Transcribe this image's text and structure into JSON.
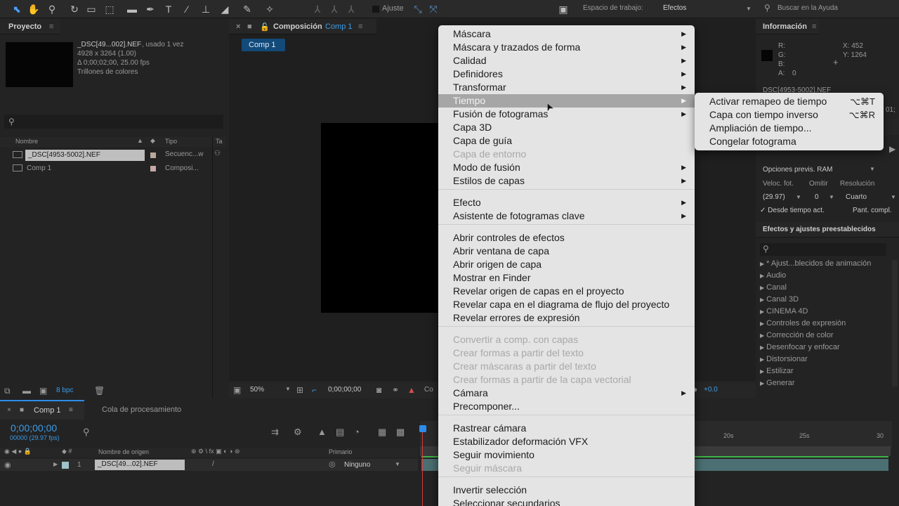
{
  "toolbar": {
    "snap_label": "Ajuste",
    "workspace_label": "Espacio de trabajo:",
    "workspace_value": "Efectos",
    "help_placeholder": "Buscar en la Ayuda"
  },
  "project": {
    "tab_label": "Proyecto",
    "footage_title": "_DSC[49...002].NEF",
    "footage_used": ", usado 1 vez",
    "footage_dims": "4928 x 3264 (1.00)",
    "footage_duration": "Δ 0;00;02;00, 25.00 fps",
    "footage_colors": "Trillones de colores",
    "col_name": "Nombre",
    "col_type": "Tipo",
    "col_size": "Ta",
    "items": [
      {
        "name": "_DSC[4953-5002].NEF",
        "type": "Secuenc...w"
      },
      {
        "name": "Comp 1",
        "type": "Composi..."
      }
    ],
    "bpc": "8 bpc"
  },
  "composition": {
    "tab_prefix": "Composición",
    "tab_name": "Comp 1",
    "subtab": "Comp 1",
    "zoom": "50%",
    "timecode": "0;00;00;00",
    "cut_label": "Co",
    "exposure": "+0.0"
  },
  "context_menu": {
    "items": [
      {
        "label": "Máscara",
        "sub": true,
        "disabled": false
      },
      {
        "label": "Máscara y trazados de forma",
        "sub": true,
        "disabled": false
      },
      {
        "label": "Calidad",
        "sub": true,
        "disabled": false
      },
      {
        "label": "Definidores",
        "sub": true,
        "disabled": false
      },
      {
        "label": "Transformar",
        "sub": true,
        "disabled": false
      },
      {
        "label": "Tiempo",
        "sub": true,
        "disabled": false,
        "highlight": true
      },
      {
        "label": "Fusión de fotogramas",
        "sub": true,
        "disabled": false
      },
      {
        "label": "Capa 3D",
        "sub": false,
        "disabled": false
      },
      {
        "label": "Capa de guía",
        "sub": false,
        "disabled": false
      },
      {
        "label": "Capa de entorno",
        "sub": false,
        "disabled": true
      },
      {
        "label": "Modo de fusión",
        "sub": true,
        "disabled": false
      },
      {
        "label": "Estilos de capas",
        "sub": true,
        "disabled": false
      },
      {
        "label": "Efecto",
        "sub": true,
        "disabled": false
      },
      {
        "label": "Asistente de fotogramas clave",
        "sub": true,
        "disabled": false
      },
      {
        "label": "Abrir controles de efectos",
        "sub": false,
        "disabled": false
      },
      {
        "label": "Abrir ventana de capa",
        "sub": false,
        "disabled": false
      },
      {
        "label": "Abrir origen de capa",
        "sub": false,
        "disabled": false
      },
      {
        "label": "Mostrar en Finder",
        "sub": false,
        "disabled": false
      },
      {
        "label": "Revelar origen de capas en el proyecto",
        "sub": false,
        "disabled": false
      },
      {
        "label": "Revelar capa en el diagrama de flujo del proyecto",
        "sub": false,
        "disabled": false
      },
      {
        "label": "Revelar errores de expresión",
        "sub": false,
        "disabled": false
      },
      {
        "label": "Convertir a comp. con capas",
        "sub": false,
        "disabled": true
      },
      {
        "label": "Crear formas a partir del texto",
        "sub": false,
        "disabled": true
      },
      {
        "label": "Crear máscaras a partir del texto",
        "sub": false,
        "disabled": true
      },
      {
        "label": "Crear formas a partir de la capa vectorial",
        "sub": false,
        "disabled": true
      },
      {
        "label": "Cámara",
        "sub": true,
        "disabled": false
      },
      {
        "label": "Precomponer...",
        "sub": false,
        "disabled": false
      },
      {
        "label": "Rastrear cámara",
        "sub": false,
        "disabled": false
      },
      {
        "label": "Estabilizador deformación VFX",
        "sub": false,
        "disabled": false
      },
      {
        "label": "Seguir movimiento",
        "sub": false,
        "disabled": false
      },
      {
        "label": "Seguir máscara",
        "sub": false,
        "disabled": true
      },
      {
        "label": "Invertir selección",
        "sub": false,
        "disabled": false
      },
      {
        "label": "Seleccionar secundarios",
        "sub": false,
        "disabled": false
      }
    ]
  },
  "submenu": {
    "items": [
      {
        "label": "Activar remapeo de tiempo",
        "shortcut": "⌥⌘T"
      },
      {
        "label": "Capa con tiempo inverso",
        "shortcut": "⌥⌘R"
      },
      {
        "label": "Ampliación de tiempo...",
        "shortcut": ""
      },
      {
        "label": "Congelar fotograma",
        "shortcut": ""
      }
    ]
  },
  "info": {
    "tab_label": "Información",
    "r": "R:",
    "g": "G:",
    "b": "B:",
    "a": "A:",
    "a_val": "0",
    "x": "X: 452",
    "y": "Y: 1264",
    "partial_name": "DSC[4953-5002].NEF",
    "partial_right": "01;"
  },
  "preview": {
    "ram_options": "Opciones previs. RAM",
    "fps_label": "Veloc. fot.",
    "skip_label": "Omitir",
    "res_label": "Resolución",
    "fps_value": "(29.97)",
    "skip_value": "0",
    "res_value": "Cuarto",
    "from_current": "✓ Desde tiempo act.",
    "full_screen": "Pant. compl."
  },
  "effects": {
    "tab_label": "Efectos y ajustes preestablecidos",
    "items": [
      "* Ajust...blecidos de animación",
      "Audio",
      "Canal",
      "Canal 3D",
      "CINEMA 4D",
      "Controles de expresión",
      "Corrección de color",
      "Desenfocar y enfocar",
      "Distorsionar",
      "Estilizar",
      "Generar"
    ]
  },
  "timeline": {
    "tab_comp": "Comp 1",
    "tab_render": "Cola de procesamiento",
    "timecode": "0;00;00;00",
    "frames": "00000 (29.97 fps)",
    "col_source": "Nombre de origen",
    "col_parent": "Primario",
    "layer_num": "1",
    "layer_name": "_DSC[49...02].NEF",
    "parent_value": "Ninguno",
    "ruler": [
      "20s",
      "25s",
      "30"
    ]
  },
  "colors": {
    "accent": "#2d8ceb",
    "timecode": "#3c9be6",
    "green": "#3fb54a",
    "menu_bg": "#e4e4e4",
    "menu_highlight": "#a6a6a6"
  }
}
